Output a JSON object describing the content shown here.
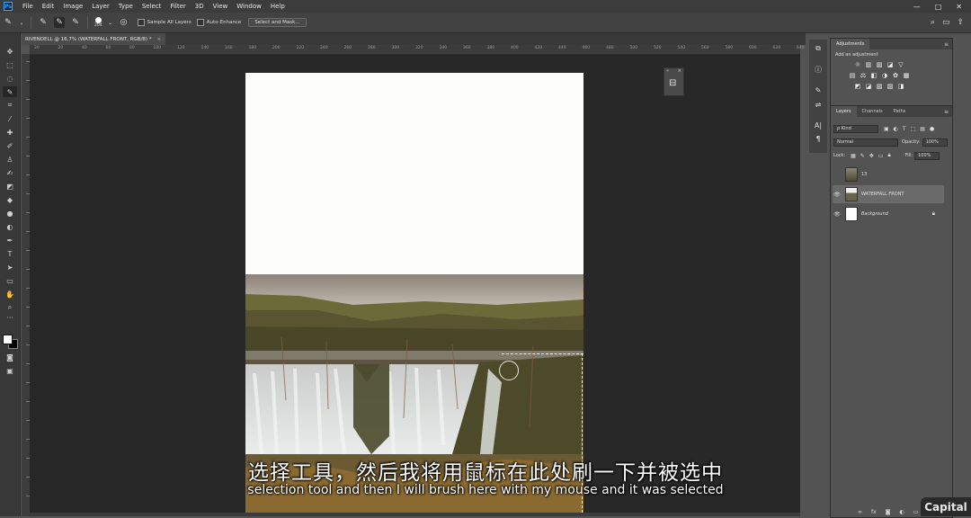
{
  "app": {
    "logo": "Ps"
  },
  "menu": [
    "File",
    "Edit",
    "Image",
    "Layer",
    "Type",
    "Select",
    "Filter",
    "3D",
    "View",
    "Window",
    "Help"
  ],
  "window_controls": {
    "minimize": "—",
    "maximize": "□",
    "close": "✕"
  },
  "options_bar": {
    "brush_size": "204",
    "sample_all_layers": "Sample All Layers",
    "auto_enhance": "Auto-Enhance",
    "select_and_mask": "Select and Mask..."
  },
  "document": {
    "tab_title": "RIVENDELL @ 16,7% (WATERFALL FRONT, RGB/8) *",
    "close": "×"
  },
  "ruler_top": [
    "20",
    "20",
    "40",
    "60",
    "80",
    "100",
    "120",
    "140",
    "160",
    "180",
    "200",
    "220",
    "240",
    "260",
    "280",
    "300",
    "320",
    "340",
    "360",
    "380",
    "400",
    "420",
    "440",
    "460",
    "480",
    "500",
    "520",
    "540",
    "560",
    "580",
    "600",
    "620",
    "640"
  ],
  "adjustments": {
    "tab": "Adjustments",
    "title": "Add an adjustment",
    "icons": [
      [
        "☼",
        "▥",
        "▨",
        "◪",
        "▽"
      ],
      [
        "▤",
        "⚖",
        "◧",
        "◑",
        "✿",
        "▦"
      ],
      [
        "◩",
        "◪",
        "▧",
        "▨",
        "◨"
      ]
    ]
  },
  "layers_panel": {
    "tabs": [
      "Layers",
      "Channels",
      "Paths"
    ],
    "filter_kind": "ρ Kind",
    "blend_mode": "Normal",
    "opacity_label": "Opacity:",
    "opacity_value": "100%",
    "lock_label": "Lock:",
    "fill_label": "Fill:",
    "fill_value": "100%",
    "layers": [
      {
        "name": "13",
        "visible": false,
        "selected": false
      },
      {
        "name": "WATERFALL FRONT",
        "visible": true,
        "selected": true
      },
      {
        "name": "Background",
        "visible": true,
        "selected": false,
        "locked": true
      }
    ]
  },
  "subtitles": {
    "zh": "选择工具，然后我将用鼠标在此处刷一下并被选中",
    "en": "selection tool and then I will brush here with my mouse and it was selected"
  },
  "watermark": "Capital",
  "colors": {
    "canvas_bg": "#282828",
    "panel_bg": "#535353",
    "menu_bg": "#3c3c3c",
    "accent": "#31a8ff"
  }
}
